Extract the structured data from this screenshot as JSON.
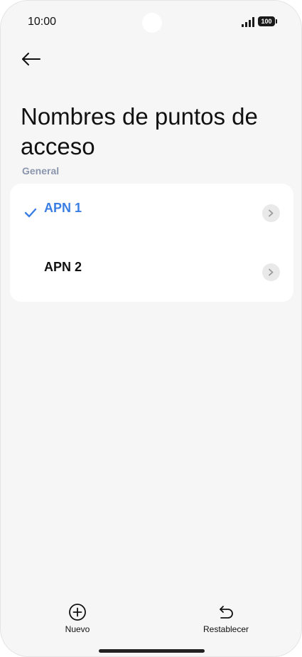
{
  "status_bar": {
    "time": "10:00",
    "battery_level": "100",
    "icons": [
      "signal-icon",
      "battery-icon"
    ]
  },
  "header": {
    "back_icon": "arrow-left-icon",
    "title": "Nombres de puntos de acceso"
  },
  "section": {
    "header": "General"
  },
  "apn_list": [
    {
      "label": "APN 1",
      "selected": true,
      "icon": "check-icon"
    },
    {
      "label": "APN 2",
      "selected": false,
      "icon": ""
    }
  ],
  "bottom_bar": {
    "new_label": "Nuevo",
    "new_icon": "plus-circle-icon",
    "reset_label": "Restablecer",
    "reset_icon": "undo-icon"
  },
  "colors": {
    "accent": "#3a7ee3",
    "background": "#f6f6f6",
    "section_header": "#8b95ad"
  }
}
